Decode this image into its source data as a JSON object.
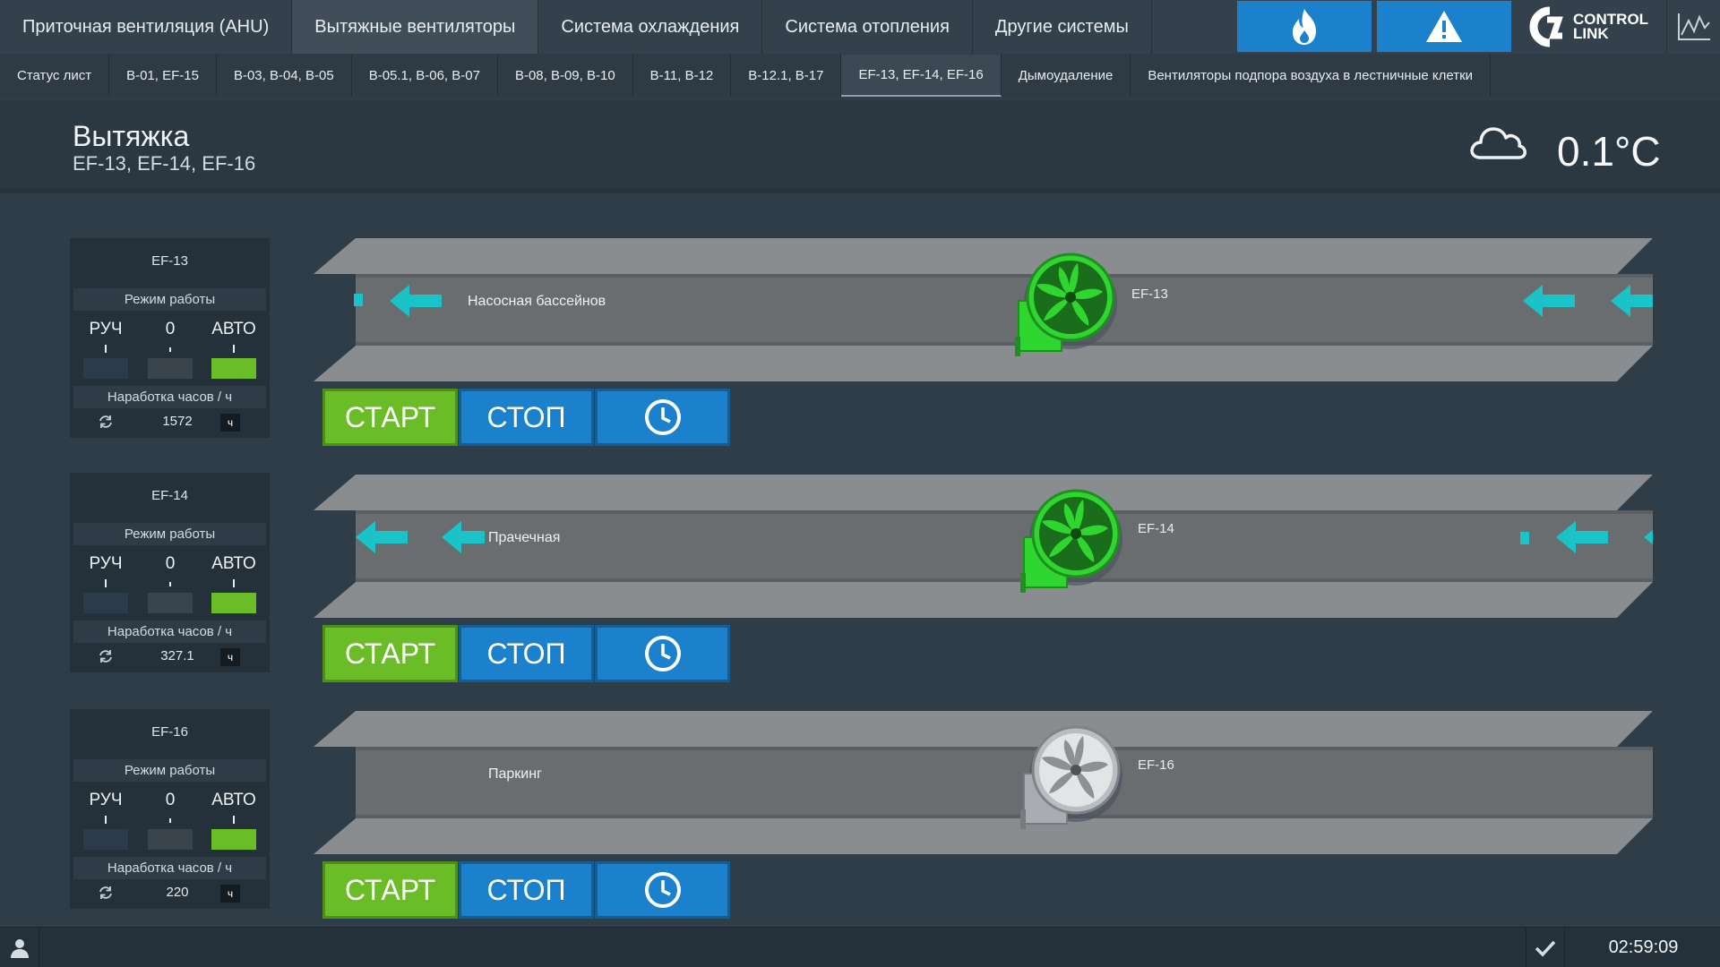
{
  "top_nav": {
    "tabs": [
      {
        "label": "Приточная вентиляция (AHU)",
        "active": false
      },
      {
        "label": "Вытяжные вентиляторы",
        "active": true
      },
      {
        "label": "Система охлаждения",
        "active": false
      },
      {
        "label": "Система отопления",
        "active": false
      },
      {
        "label": "Другие системы",
        "active": false
      }
    ],
    "fire_icon": "fire-icon",
    "alarm_icon": "warning-icon",
    "logo": {
      "line1": "CONTROL",
      "line2": "LINK"
    },
    "trend_icon": "trend-chart-icon",
    "accent_color": "#1b81cc"
  },
  "sub_nav": {
    "tabs": [
      {
        "label": "Статус лист",
        "active": false
      },
      {
        "label": "B-01, EF-15",
        "active": false
      },
      {
        "label": "B-03, B-04, B-05",
        "active": false
      },
      {
        "label": "B-05.1, B-06, B-07",
        "active": false
      },
      {
        "label": "B-08, B-09, B-10",
        "active": false
      },
      {
        "label": "B-11, B-12",
        "active": false
      },
      {
        "label": "B-12.1, B-17",
        "active": false
      },
      {
        "label": "EF-13, EF-14, EF-16",
        "active": true
      },
      {
        "label": "Дымоудаление",
        "active": false
      },
      {
        "label": "Вентиляторы подпора воздуха в лестничные клетки",
        "active": false
      }
    ]
  },
  "header": {
    "title": "Вытяжка",
    "subtitle": "EF-13, EF-14, EF-16",
    "weather_icon": "cloud-icon",
    "temperature": "0.1°C"
  },
  "units": [
    {
      "name": "EF-13",
      "mode_header": "Режим работы",
      "mode_labels": [
        "РУЧ",
        "0",
        "АВТО"
      ],
      "mode_selected": "АВТО",
      "hours_header": "Наработка часов / ч",
      "hours_value": "1572",
      "hours_unit": "ч",
      "location": "Насосная бассейнов",
      "fan_label": "EF-13",
      "fan_running": true,
      "buttons": {
        "start": "СТАРТ",
        "stop": "СТОП",
        "schedule_icon": "clock-icon"
      }
    },
    {
      "name": "EF-14",
      "mode_header": "Режим работы",
      "mode_labels": [
        "РУЧ",
        "0",
        "АВТО"
      ],
      "mode_selected": "АВТО",
      "hours_header": "Наработка часов / ч",
      "hours_value": "327.1",
      "hours_unit": "ч",
      "location": "Прачечная",
      "fan_label": "EF-14",
      "fan_running": true,
      "buttons": {
        "start": "СТАРТ",
        "stop": "СТОП",
        "schedule_icon": "clock-icon"
      }
    },
    {
      "name": "EF-16",
      "mode_header": "Режим работы",
      "mode_labels": [
        "РУЧ",
        "0",
        "АВТО"
      ],
      "mode_selected": "АВТО",
      "hours_header": "Наработка часов / ч",
      "hours_value": "220",
      "hours_unit": "ч",
      "location": "Паркинг",
      "fan_label": "EF-16",
      "fan_running": false,
      "buttons": {
        "start": "СТАРТ",
        "stop": "СТОП",
        "schedule_icon": "clock-icon"
      }
    }
  ],
  "status_bar": {
    "user_icon": "user-icon",
    "ack_icon": "checkmark-icon",
    "time": "02:59:09"
  },
  "colors": {
    "running_green": "#2fd62f",
    "auto_green": "#6bbd28",
    "arrow_cyan": "#19c3c8"
  }
}
